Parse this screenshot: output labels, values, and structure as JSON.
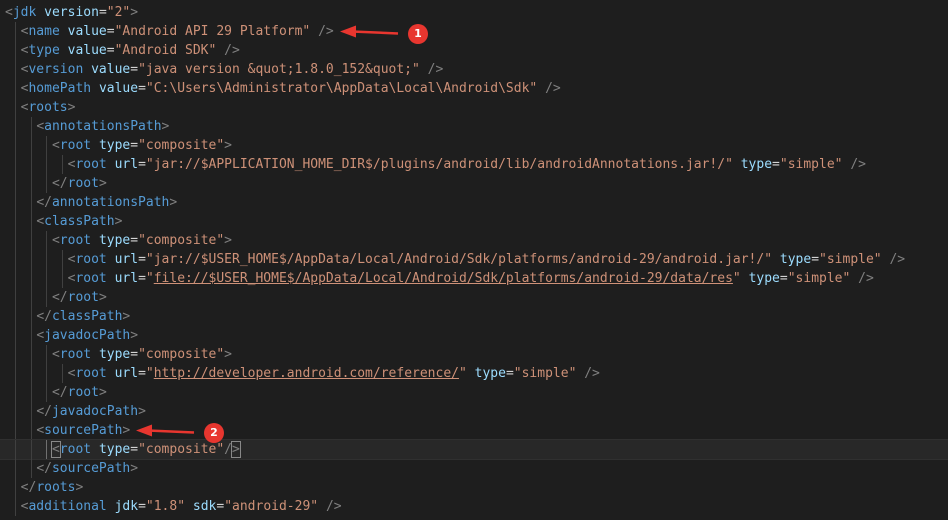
{
  "editor": {
    "lines": [
      {
        "indent": 0,
        "tokens": [
          [
            "p",
            "<"
          ],
          [
            "t",
            "jdk"
          ],
          [
            "x",
            " "
          ],
          [
            "a",
            "version"
          ],
          [
            "x",
            "="
          ],
          [
            "s",
            "\"2\""
          ],
          [
            "p",
            ">"
          ]
        ]
      },
      {
        "indent": 1,
        "tokens": [
          [
            "p",
            "<"
          ],
          [
            "t",
            "name"
          ],
          [
            "x",
            " "
          ],
          [
            "a",
            "value"
          ],
          [
            "x",
            "="
          ],
          [
            "s",
            "\"Android API 29 Platform\""
          ],
          [
            "x",
            " "
          ],
          [
            "p",
            "/>"
          ]
        ]
      },
      {
        "indent": 1,
        "tokens": [
          [
            "p",
            "<"
          ],
          [
            "t",
            "type"
          ],
          [
            "x",
            " "
          ],
          [
            "a",
            "value"
          ],
          [
            "x",
            "="
          ],
          [
            "s",
            "\"Android SDK\""
          ],
          [
            "x",
            " "
          ],
          [
            "p",
            "/>"
          ]
        ]
      },
      {
        "indent": 1,
        "tokens": [
          [
            "p",
            "<"
          ],
          [
            "t",
            "version"
          ],
          [
            "x",
            " "
          ],
          [
            "a",
            "value"
          ],
          [
            "x",
            "="
          ],
          [
            "s",
            "\"java version &quot;1.8.0_152&quot;\""
          ],
          [
            "x",
            " "
          ],
          [
            "p",
            "/>"
          ]
        ]
      },
      {
        "indent": 1,
        "tokens": [
          [
            "p",
            "<"
          ],
          [
            "t",
            "homePath"
          ],
          [
            "x",
            " "
          ],
          [
            "a",
            "value"
          ],
          [
            "x",
            "="
          ],
          [
            "s",
            "\"C:\\Users\\Administrator\\AppData\\Local\\Android\\Sdk\""
          ],
          [
            "x",
            " "
          ],
          [
            "p",
            "/>"
          ]
        ]
      },
      {
        "indent": 1,
        "tokens": [
          [
            "p",
            "<"
          ],
          [
            "t",
            "roots"
          ],
          [
            "p",
            ">"
          ]
        ]
      },
      {
        "indent": 2,
        "tokens": [
          [
            "p",
            "<"
          ],
          [
            "t",
            "annotationsPath"
          ],
          [
            "p",
            ">"
          ]
        ]
      },
      {
        "indent": 3,
        "tokens": [
          [
            "p",
            "<"
          ],
          [
            "t",
            "root"
          ],
          [
            "x",
            " "
          ],
          [
            "a",
            "type"
          ],
          [
            "x",
            "="
          ],
          [
            "s",
            "\"composite\""
          ],
          [
            "p",
            ">"
          ]
        ]
      },
      {
        "indent": 4,
        "tokens": [
          [
            "p",
            "<"
          ],
          [
            "t",
            "root"
          ],
          [
            "x",
            " "
          ],
          [
            "a",
            "url"
          ],
          [
            "x",
            "="
          ],
          [
            "s",
            "\"jar://$APPLICATION_HOME_DIR$/plugins/android/lib/androidAnnotations.jar!/\""
          ],
          [
            "x",
            " "
          ],
          [
            "a",
            "type"
          ],
          [
            "x",
            "="
          ],
          [
            "s",
            "\"simple\""
          ],
          [
            "x",
            " "
          ],
          [
            "p",
            "/>"
          ]
        ]
      },
      {
        "indent": 3,
        "tokens": [
          [
            "p",
            "</"
          ],
          [
            "t",
            "root"
          ],
          [
            "p",
            ">"
          ]
        ]
      },
      {
        "indent": 2,
        "tokens": [
          [
            "p",
            "</"
          ],
          [
            "t",
            "annotationsPath"
          ],
          [
            "p",
            ">"
          ]
        ]
      },
      {
        "indent": 2,
        "tokens": [
          [
            "p",
            "<"
          ],
          [
            "t",
            "classPath"
          ],
          [
            "p",
            ">"
          ]
        ]
      },
      {
        "indent": 3,
        "tokens": [
          [
            "p",
            "<"
          ],
          [
            "t",
            "root"
          ],
          [
            "x",
            " "
          ],
          [
            "a",
            "type"
          ],
          [
            "x",
            "="
          ],
          [
            "s",
            "\"composite\""
          ],
          [
            "p",
            ">"
          ]
        ]
      },
      {
        "indent": 4,
        "tokens": [
          [
            "p",
            "<"
          ],
          [
            "t",
            "root"
          ],
          [
            "x",
            " "
          ],
          [
            "a",
            "url"
          ],
          [
            "x",
            "="
          ],
          [
            "s",
            "\"jar://$USER_HOME$/AppData/Local/Android/Sdk/platforms/android-29/android.jar!/\""
          ],
          [
            "x",
            " "
          ],
          [
            "a",
            "type"
          ],
          [
            "x",
            "="
          ],
          [
            "s",
            "\"simple\""
          ],
          [
            "x",
            " "
          ],
          [
            "p",
            "/>"
          ]
        ]
      },
      {
        "indent": 4,
        "tokens": [
          [
            "p",
            "<"
          ],
          [
            "t",
            "root"
          ],
          [
            "x",
            " "
          ],
          [
            "a",
            "url"
          ],
          [
            "x",
            "="
          ],
          [
            "s",
            "\""
          ],
          [
            "sl",
            "file://$USER_HOME$/AppData/Local/Android/Sdk/platforms/android-29/data/res"
          ],
          [
            "s",
            "\""
          ],
          [
            "x",
            " "
          ],
          [
            "a",
            "type"
          ],
          [
            "x",
            "="
          ],
          [
            "s",
            "\"simple\""
          ],
          [
            "x",
            " "
          ],
          [
            "p",
            "/>"
          ]
        ]
      },
      {
        "indent": 3,
        "tokens": [
          [
            "p",
            "</"
          ],
          [
            "t",
            "root"
          ],
          [
            "p",
            ">"
          ]
        ]
      },
      {
        "indent": 2,
        "tokens": [
          [
            "p",
            "</"
          ],
          [
            "t",
            "classPath"
          ],
          [
            "p",
            ">"
          ]
        ]
      },
      {
        "indent": 2,
        "tokens": [
          [
            "p",
            "<"
          ],
          [
            "t",
            "javadocPath"
          ],
          [
            "p",
            ">"
          ]
        ]
      },
      {
        "indent": 3,
        "tokens": [
          [
            "p",
            "<"
          ],
          [
            "t",
            "root"
          ],
          [
            "x",
            " "
          ],
          [
            "a",
            "type"
          ],
          [
            "x",
            "="
          ],
          [
            "s",
            "\"composite\""
          ],
          [
            "p",
            ">"
          ]
        ]
      },
      {
        "indent": 4,
        "tokens": [
          [
            "p",
            "<"
          ],
          [
            "t",
            "root"
          ],
          [
            "x",
            " "
          ],
          [
            "a",
            "url"
          ],
          [
            "x",
            "="
          ],
          [
            "s",
            "\""
          ],
          [
            "sl",
            "http://developer.android.com/reference/"
          ],
          [
            "s",
            "\""
          ],
          [
            "x",
            " "
          ],
          [
            "a",
            "type"
          ],
          [
            "x",
            "="
          ],
          [
            "s",
            "\"simple\""
          ],
          [
            "x",
            " "
          ],
          [
            "p",
            "/>"
          ]
        ]
      },
      {
        "indent": 3,
        "tokens": [
          [
            "p",
            "</"
          ],
          [
            "t",
            "root"
          ],
          [
            "p",
            ">"
          ]
        ]
      },
      {
        "indent": 2,
        "tokens": [
          [
            "p",
            "</"
          ],
          [
            "t",
            "javadocPath"
          ],
          [
            "p",
            ">"
          ]
        ]
      },
      {
        "indent": 2,
        "tokens": [
          [
            "p",
            "<"
          ],
          [
            "t",
            "sourcePath"
          ],
          [
            "p",
            ">"
          ]
        ]
      },
      {
        "indent": 3,
        "current": true,
        "tokens": [
          [
            "pb",
            "<"
          ],
          [
            "t",
            "root"
          ],
          [
            "x",
            " "
          ],
          [
            "a",
            "type"
          ],
          [
            "x",
            "="
          ],
          [
            "s",
            "\"composite\""
          ],
          [
            "p",
            "/"
          ],
          [
            "cursor",
            ""
          ],
          [
            "pb",
            ">"
          ]
        ]
      },
      {
        "indent": 2,
        "tokens": [
          [
            "p",
            "</"
          ],
          [
            "t",
            "sourcePath"
          ],
          [
            "p",
            ">"
          ]
        ]
      },
      {
        "indent": 1,
        "tokens": [
          [
            "p",
            "</"
          ],
          [
            "t",
            "roots"
          ],
          [
            "p",
            ">"
          ]
        ]
      },
      {
        "indent": 1,
        "tokens": [
          [
            "p",
            "<"
          ],
          [
            "t",
            "additional"
          ],
          [
            "x",
            " "
          ],
          [
            "a",
            "jdk"
          ],
          [
            "x",
            "="
          ],
          [
            "s",
            "\"1.8\""
          ],
          [
            "x",
            " "
          ],
          [
            "a",
            "sdk"
          ],
          [
            "x",
            "="
          ],
          [
            "s",
            "\"android-29\""
          ],
          [
            "x",
            " "
          ],
          [
            "p",
            "/>"
          ]
        ]
      }
    ]
  },
  "annotations": [
    {
      "label": "1",
      "line": 1
    },
    {
      "label": "2",
      "line": 22
    }
  ],
  "colors": {
    "background": "#1e1e1e",
    "punctuation": "#808080",
    "tag": "#569cd6",
    "attribute": "#9cdcfe",
    "string": "#ce9178",
    "marker": "#e8362f"
  }
}
